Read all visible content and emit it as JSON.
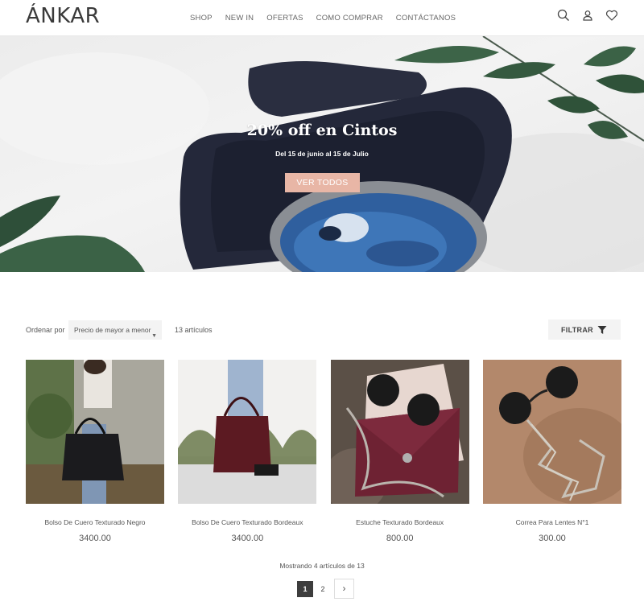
{
  "brand": {
    "logo_text": "ÁNKAR"
  },
  "nav": {
    "items": [
      "SHOP",
      "NEW IN",
      "OFERTAS",
      "COMO COMPRAR",
      "CONTÁCTANOS"
    ]
  },
  "header_icons": [
    "search-icon",
    "user-icon",
    "heart-icon"
  ],
  "hero": {
    "title": "20% off en Cintos",
    "subtitle": "Del 15 de junio al 15 de Julio",
    "button_label": "VER TODOS",
    "button_color": "#e8b6a6"
  },
  "toolbar": {
    "sort_label": "Ordenar por",
    "sort_value": "Precio de mayor a menor",
    "count_text": "13 artículos",
    "filter_label": "FILTRAR"
  },
  "products": [
    {
      "name": "Bolso De Cuero Texturado Negro",
      "price": "3400.00"
    },
    {
      "name": "Bolso De Cuero Texturado Bordeaux",
      "price": "3400.00"
    },
    {
      "name": "Estuche Texturado Bordeaux",
      "price": "800.00"
    },
    {
      "name": "Correa Para Lentes N°1",
      "price": "300.00"
    }
  ],
  "pagination": {
    "showing_text": "Mostrando 4 artículos de 13",
    "pages": [
      "1",
      "2"
    ],
    "current_page": "1",
    "next_symbol": "›"
  }
}
